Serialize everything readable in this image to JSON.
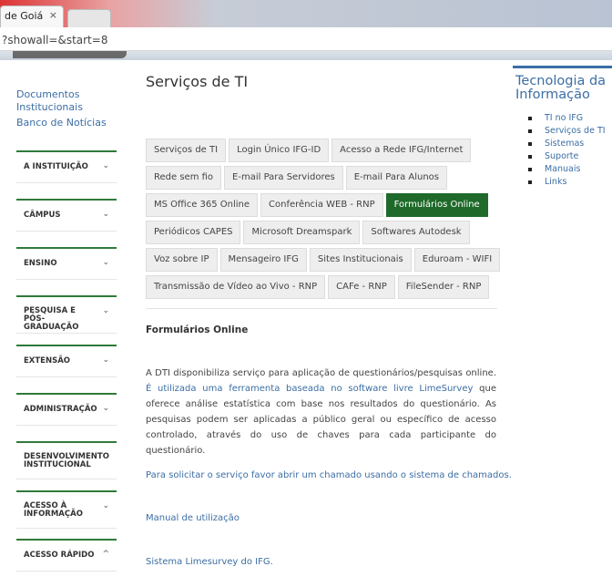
{
  "browser": {
    "tab_title": "de Goiá",
    "tab_close": "×",
    "address": "?showall=&start=8"
  },
  "left_sidebar": {
    "links": [
      "Documentos Institucionais",
      "Banco de Notícias"
    ],
    "categories": [
      {
        "label": "A INSTITUIÇÃO",
        "chevron": "⌄"
      },
      {
        "label": "CÂMPUS",
        "chevron": "⌄"
      },
      {
        "label": "ENSINO",
        "chevron": "⌄"
      },
      {
        "label": "PESQUISA E PÓS-GRADUAÇÃO",
        "chevron": "⌄"
      },
      {
        "label": "EXTENSÃO",
        "chevron": "⌄"
      },
      {
        "label": "ADMINISTRAÇÃO",
        "chevron": "⌄"
      },
      {
        "label": "DESENVOLVIMENTO INSTITUCIONAL",
        "chevron": "⌄"
      },
      {
        "label": "ACESSO À INFORMAÇÃO",
        "chevron": "⌄"
      },
      {
        "label": "ACESSO RÁPIDO",
        "chevron": "^"
      }
    ]
  },
  "main": {
    "title": "Serviços de TI",
    "tab_rows": [
      [
        "Serviços de TI",
        "Login Único IFG-ID",
        "Acesso a Rede IFG/Internet"
      ],
      [
        "Rede sem fio",
        "E-mail Para Servidores",
        "E-mail Para Alunos"
      ],
      [
        "MS Office 365 Online",
        "Conferência WEB - RNP",
        "Formulários Online"
      ],
      [
        "Periódicos CAPES",
        "Microsoft Dreamspark",
        "Softwares Autodesk"
      ],
      [
        "Voz sobre IP",
        "Mensageiro IFG",
        "Sites Institucionais",
        "Eduroam - WIFI"
      ],
      [
        "Transmissão de Vídeo ao Vivo - RNP",
        "CAFe - RNP",
        "FileSender - RNP"
      ]
    ],
    "active_tab": "Formulários Online",
    "section_title": "Formulários Online",
    "paragraph_start": "A DTI disponibiliza serviço para aplicação de questionários/pesquisas online. ",
    "paragraph_link": "É utilizada uma ferramenta baseada no software livre LimeSurvey",
    "paragraph_end": " que oferece análise estatística com base nos resultados do questionário. As pesquisas podem ser aplicadas a público geral ou específico de acesso controlado, através do uso de chaves para cada participante do questionário.",
    "link_request": "Para solicitar o serviço favor abrir um chamado usando o sistema de chamados.",
    "link_manual": "Manual de utilização",
    "link_system": "Sistema Limesurvey do IFG."
  },
  "right_sidebar": {
    "title": "Tecnologia da Informação",
    "items": [
      "TI no IFG",
      "Serviços de TI",
      "Sistemas",
      "Suporte",
      "Manuais",
      "Links"
    ]
  },
  "colors": {
    "accent_green": "#1f6a2a",
    "link_blue": "#3b6ea5"
  }
}
